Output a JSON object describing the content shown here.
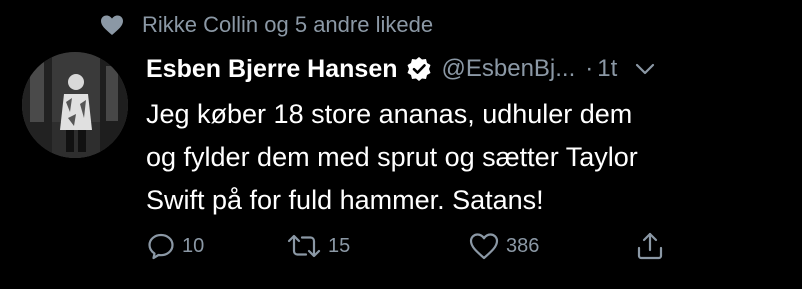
{
  "social_context": {
    "text": "Rikke Collin og 5 andre likede",
    "icon": "heart-icon"
  },
  "author": {
    "name": "Esben Bjerre Hansen",
    "handle": "@EsbenBj...",
    "verified": true,
    "avatar": "avatar"
  },
  "meta": {
    "separator": "·",
    "time": "1t"
  },
  "tweet": {
    "text": "Jeg køber 18 store ananas, udhuler dem\nog fylder dem med sprut og sætter Taylor\nSwift på for fuld hammer. Satans!"
  },
  "actions": {
    "reply": {
      "icon": "reply-icon",
      "count": "10"
    },
    "retweet": {
      "icon": "retweet-icon",
      "count": "15"
    },
    "like": {
      "icon": "like-icon",
      "count": "386"
    },
    "share": {
      "icon": "share-icon"
    }
  },
  "colors": {
    "background": "#000000",
    "text": "#ffffff",
    "secondary": "#8b98a5",
    "verified": "#ffffff"
  }
}
